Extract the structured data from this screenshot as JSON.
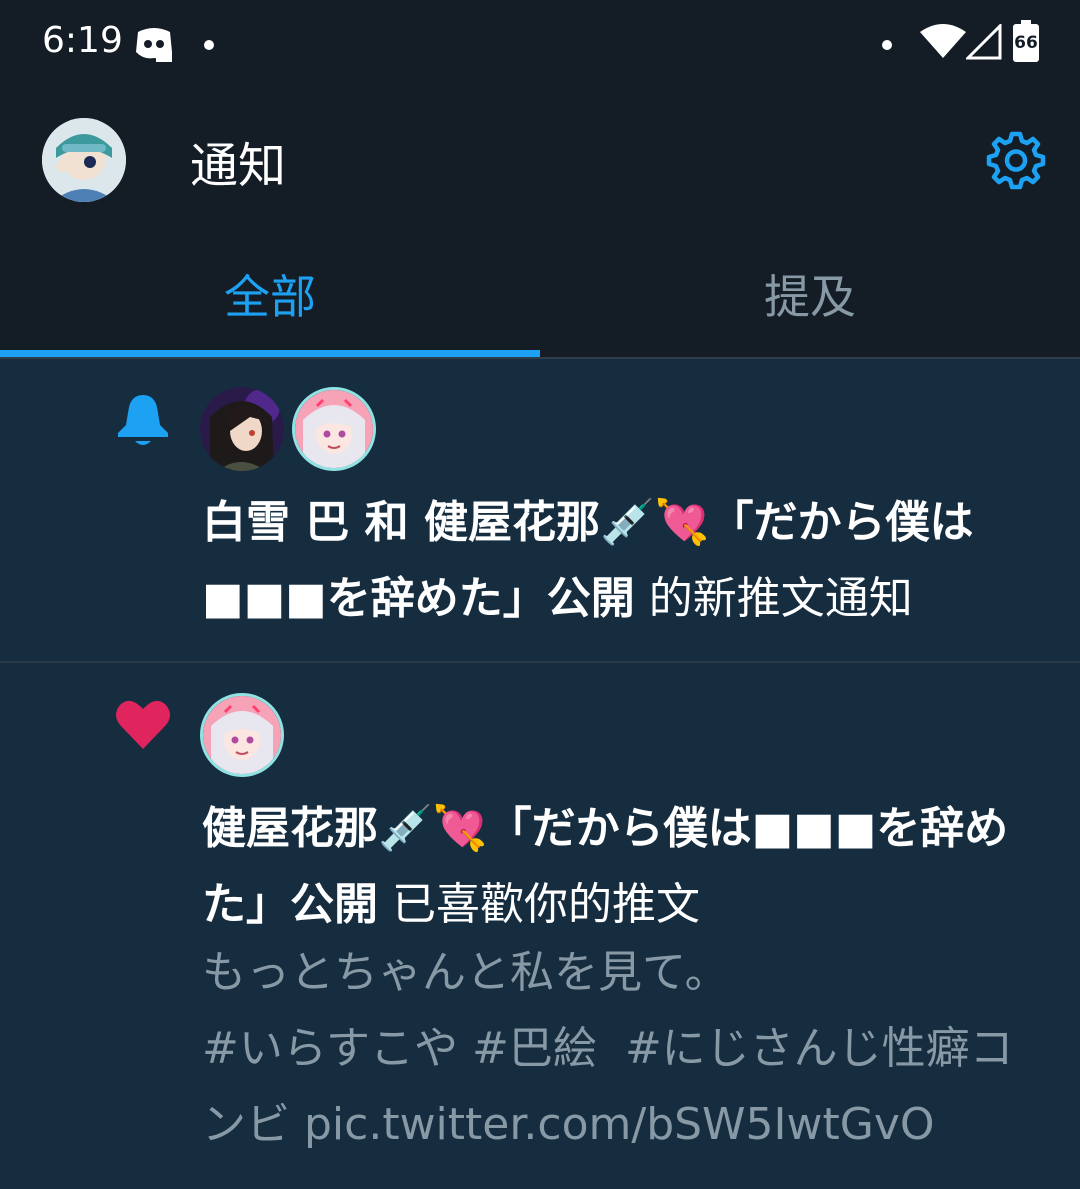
{
  "status_bar": {
    "time": "6:19",
    "battery": "66",
    "icons": [
      "discord-icon",
      "dot-icon",
      "wifi-icon",
      "signal-icon",
      "battery-icon"
    ]
  },
  "header": {
    "title": "通知",
    "settings_icon": "gear-icon",
    "accent_color": "#1da1f2"
  },
  "tabs": [
    {
      "label": "全部",
      "active": true
    },
    {
      "label": "提及",
      "active": false
    }
  ],
  "notifications": [
    {
      "type": "bell-icon",
      "users": "白雪 巴 和 健屋花那💉💘「だから僕は■■■を辞めた」公開",
      "action": " 的新推文通知"
    },
    {
      "type": "heart-icon",
      "users": "健屋花那💉💘「だから僕は■■■を辞めた」公開",
      "action": " 已喜歡你的推文",
      "tweet_text": "もっとちゃんと私を見て。\n#いらすこや #巴絵  #にじさんじ性癖コンビ pic.twitter.com/bSW5IwtGvO"
    }
  ]
}
